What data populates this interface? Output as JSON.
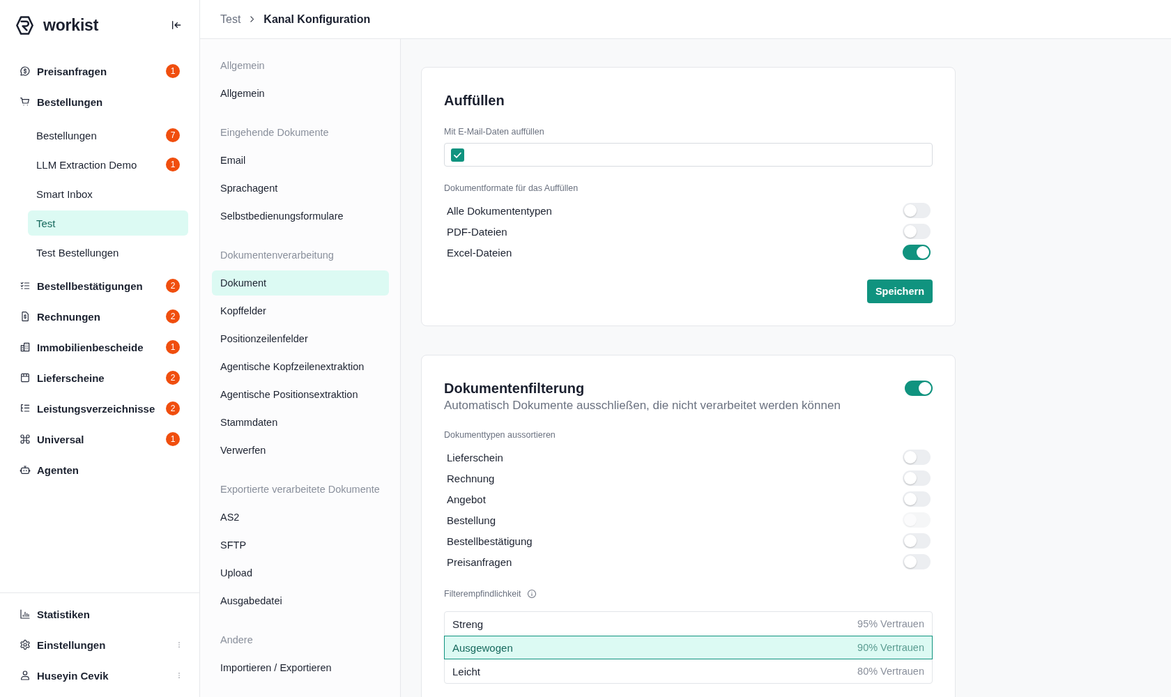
{
  "sidebar": {
    "brand": "workist",
    "nav": [
      {
        "label": "Preisanfragen",
        "badge": "1",
        "selected": false
      },
      {
        "label": "Bestellungen",
        "selected": false,
        "children": [
          {
            "label": "Bestellungen",
            "badge": "7",
            "selected": false
          },
          {
            "label": "LLM Extraction Demo",
            "badge": "1",
            "selected": false
          },
          {
            "label": "Smart Inbox",
            "selected": false
          },
          {
            "label": "Test",
            "selected": true
          },
          {
            "label": "Test Bestellungen",
            "selected": false
          }
        ]
      },
      {
        "label": "Bestellbestätigungen",
        "badge": "2",
        "selected": false
      },
      {
        "label": "Rechnungen",
        "badge": "2",
        "selected": false
      },
      {
        "label": "Immobilienbescheide",
        "badge": "1",
        "selected": false
      },
      {
        "label": "Lieferscheine",
        "badge": "2",
        "selected": false
      },
      {
        "label": "Leistungsverzeichnisse",
        "badge": "2",
        "selected": false
      },
      {
        "label": "Universal",
        "badge": "1",
        "selected": false
      },
      {
        "label": "Agenten",
        "selected": false
      }
    ],
    "footer": [
      {
        "label": "Statistiken",
        "kind": "link"
      },
      {
        "label": "Einstellungen",
        "kind": "menu"
      },
      {
        "label": "Huseyin Cevik",
        "kind": "menu"
      }
    ]
  },
  "breadcrumb": [
    "Test",
    "Kanal Konfiguration"
  ],
  "settings_nav": [
    {
      "title": "Allgemein",
      "items": [
        {
          "label": "Allgemein",
          "selected": false
        }
      ]
    },
    {
      "title": "Eingehende Dokumente",
      "items": [
        {
          "label": "Email",
          "selected": false
        },
        {
          "label": "Sprachagent",
          "selected": false
        },
        {
          "label": "Selbstbedienungsformulare",
          "selected": false
        }
      ]
    },
    {
      "title": "Dokumentenverarbeitung",
      "items": [
        {
          "label": "Dokument",
          "selected": true
        },
        {
          "label": "Kopffelder",
          "selected": false
        },
        {
          "label": "Positionzeilenfelder",
          "selected": false
        },
        {
          "label": "Agentische Kopfzeilenextraktion",
          "selected": false
        },
        {
          "label": "Agentische Positionsextraktion",
          "selected": false
        },
        {
          "label": "Stammdaten",
          "selected": false
        },
        {
          "label": "Verwerfen",
          "selected": false
        }
      ]
    },
    {
      "title": "Exportierte verarbeitete Dokumente",
      "items": [
        {
          "label": "AS2",
          "selected": false
        },
        {
          "label": "SFTP",
          "selected": false
        },
        {
          "label": "Upload",
          "selected": false
        },
        {
          "label": "Ausgabedatei",
          "selected": false
        }
      ]
    },
    {
      "title": "Andere",
      "items": [
        {
          "label": "Importieren / Exportieren",
          "selected": false
        }
      ]
    }
  ],
  "fill_card": {
    "title": "Auffüllen",
    "email_fill": {
      "label": "Mit E-Mail-Daten auffüllen",
      "checked": true
    },
    "formats": {
      "label": "Dokumentformate für das Auffüllen",
      "options": [
        {
          "label": "Alle Dokumententypen",
          "on": false
        },
        {
          "label": "PDF-Dateien",
          "on": false
        },
        {
          "label": "Excel-Dateien",
          "on": true
        }
      ]
    },
    "save_button": "Speichern"
  },
  "filter_card": {
    "title": "Dokumentenfilterung",
    "on": true,
    "subtitle": "Automatisch Dokumente ausschließen, die nicht verarbeitet werden können",
    "types": {
      "label": "Dokumenttypen aussortieren",
      "options": [
        {
          "label": "Lieferschein",
          "on": false,
          "disabled": false
        },
        {
          "label": "Rechnung",
          "on": false,
          "disabled": false
        },
        {
          "label": "Angebot",
          "on": false,
          "disabled": false
        },
        {
          "label": "Bestellung",
          "on": false,
          "disabled": true
        },
        {
          "label": "Bestellbestätigung",
          "on": false,
          "disabled": false
        },
        {
          "label": "Preisanfragen",
          "on": false,
          "disabled": false
        }
      ]
    },
    "sensitivity": {
      "label": "Filterempfindlichkeit",
      "options": [
        {
          "label": "Streng",
          "reading": "95% Vertrauen",
          "selected": false
        },
        {
          "label": "Ausgewogen",
          "reading": "90% Vertrauen",
          "selected": true
        },
        {
          "label": "Leicht",
          "reading": "80% Vertrauen",
          "selected": false
        }
      ]
    }
  }
}
